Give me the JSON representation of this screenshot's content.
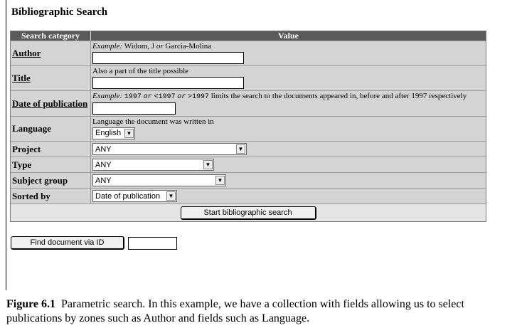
{
  "heading": "Bibliographic Search",
  "table": {
    "header_category": "Search category",
    "header_value": "Value"
  },
  "author": {
    "label": "Author",
    "hint_prefix": "Example:",
    "hint_text_a": "Widom, J",
    "hint_or": "or",
    "hint_text_b": "Garcia-Molina",
    "value": ""
  },
  "title_field": {
    "label": "Title",
    "hint": "Also a part of the title possible",
    "value": ""
  },
  "date": {
    "label": "Date of publication",
    "hint_prefix": "Example:",
    "code1": "1997",
    "or1": "or",
    "code2": "<1997",
    "or2": "or",
    "code3": ">1997",
    "hint_rest": "limits the search to the documents appeared in, before and after 1997 respectively",
    "value": ""
  },
  "language": {
    "label": "Language",
    "hint": "Language the document was written in",
    "selected": "English"
  },
  "project": {
    "label": "Project",
    "selected": "ANY"
  },
  "type_field": {
    "label": "Type",
    "selected": "ANY"
  },
  "subject_group": {
    "label": "Subject group",
    "selected": "ANY"
  },
  "sorted_by": {
    "label": "Sorted by",
    "selected": "Date of publication"
  },
  "start_button": "Start bibliographic search",
  "find_button": "Find document via ID",
  "doc_id_value": "",
  "caption": {
    "figure_label": "Figure 6.1",
    "text": "Parametric search. In this example, we have a collection with fields allowing us to select publications by zones such as Author and fields such as Language."
  },
  "icons": {
    "dropdown": "chevron-down-icon"
  }
}
